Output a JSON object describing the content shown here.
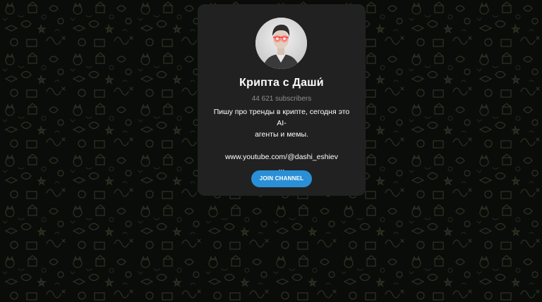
{
  "channel": {
    "title": "Крипта с Даши́",
    "subscribers": "44 621 subscribers",
    "description_line1": "Пишу про тренды в крипте, сегодня это AI-",
    "description_line2": "агенты и мемы.",
    "link": "www.youtube.com/@dashi_eshiev",
    "more": "...",
    "join_label": "JOIN CHANNEL"
  },
  "colors": {
    "background": "#0a0c09",
    "card": "#212121",
    "accent": "#2a8fd6",
    "muted_text": "#8e8e8e"
  },
  "icons": {
    "background_pattern": "doodle-pattern-icon",
    "avatar": "channel-avatar"
  }
}
